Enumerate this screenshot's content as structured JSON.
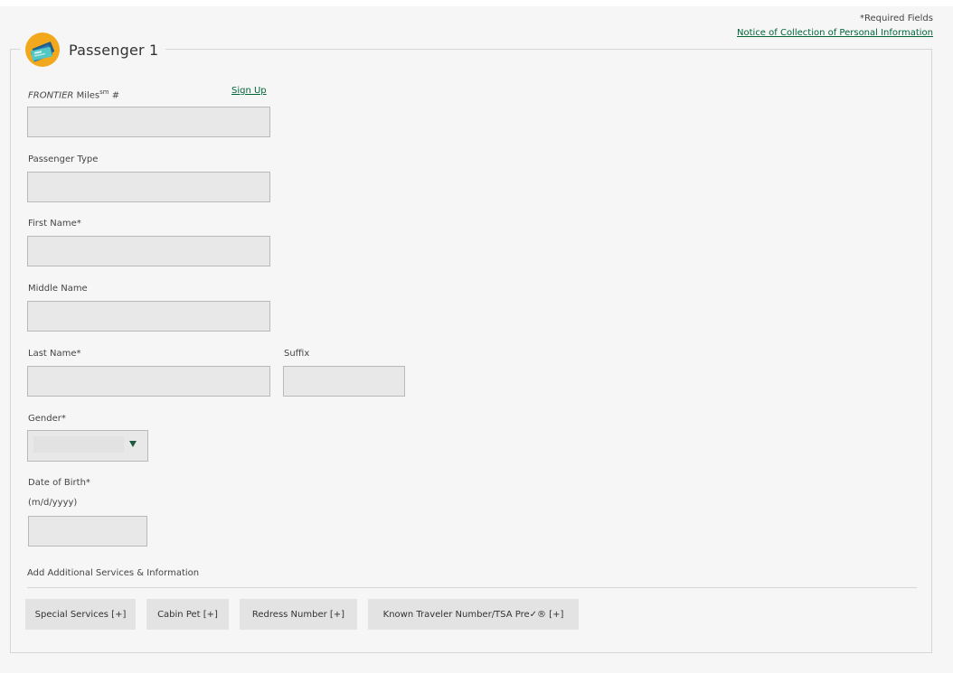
{
  "header": {
    "required_note": "*Required Fields",
    "notice_link": "Notice of Collection of Personal Information"
  },
  "passenger": {
    "title": "Passenger 1",
    "icon": "ticket-icon",
    "colors": {
      "icon_bg": "#f2a81d",
      "link": "#00653a",
      "caret": "#1e5a3f"
    }
  },
  "fields": {
    "miles_brand": "FRONTIER",
    "miles_text": " Miles",
    "miles_sup": "sm",
    "miles_suffix": " #",
    "signup_link": "Sign Up",
    "miles_value": "",
    "passenger_type_label": "Passenger Type",
    "passenger_type_value": "",
    "first_name_label": "First Name*",
    "first_name_value": "",
    "middle_name_label": "Middle Name",
    "middle_name_value": "",
    "last_name_label": "Last Name*",
    "last_name_value": "",
    "suffix_label": "Suffix",
    "suffix_value": "",
    "gender_label": "Gender*",
    "gender_value": "",
    "dob_label": "Date of Birth*",
    "dob_hint": "(m/d/yyyy)",
    "dob_value": ""
  },
  "additional": {
    "heading": "Add Additional Services & Information",
    "buttons": [
      "Special Services [+]",
      "Cabin Pet [+]",
      "Redress Number [+]",
      "Known Traveler Number/TSA Pre✓® [+]"
    ]
  }
}
